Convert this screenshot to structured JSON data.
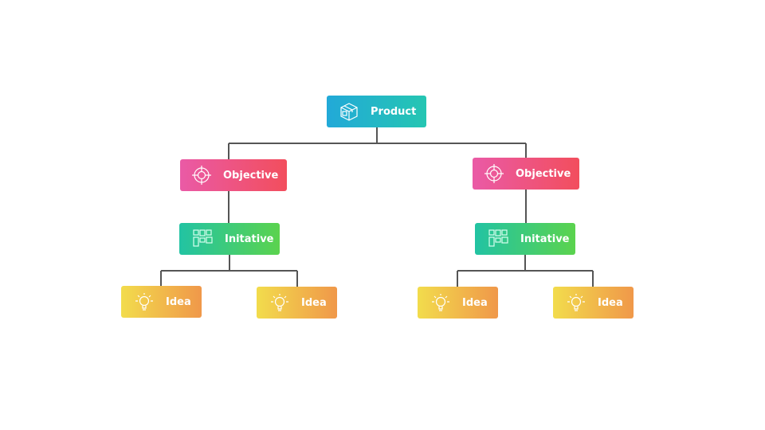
{
  "root": {
    "label": "Product",
    "icon": "box-icon"
  },
  "branches": [
    {
      "objective": {
        "label": "Objective",
        "icon": "target-icon"
      },
      "initiative": {
        "label": "Initative",
        "icon": "grid-blocks-icon"
      },
      "ideas": [
        {
          "label": "Idea",
          "icon": "lightbulb-icon"
        },
        {
          "label": "Idea",
          "icon": "lightbulb-icon"
        }
      ]
    },
    {
      "objective": {
        "label": "Objective",
        "icon": "target-icon"
      },
      "initiative": {
        "label": "Initative",
        "icon": "grid-blocks-icon"
      },
      "ideas": [
        {
          "label": "Idea",
          "icon": "lightbulb-icon"
        },
        {
          "label": "Idea",
          "icon": "lightbulb-icon"
        }
      ]
    }
  ],
  "colors": {
    "product": [
      "#22a9d8",
      "#25c6b2"
    ],
    "objective": [
      "#ea5aa6",
      "#f24e5d"
    ],
    "initiative": [
      "#22c3a3",
      "#5bd34e"
    ],
    "idea": [
      "#f2dc4c",
      "#f0984a"
    ],
    "connector": "#555555"
  }
}
